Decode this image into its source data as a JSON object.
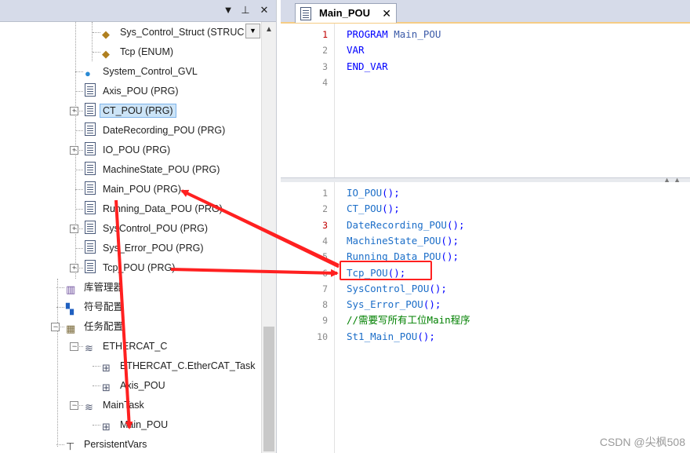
{
  "tree": {
    "rows": [
      {
        "label": "Sys_Control_Struct (STRUC",
        "icon": "struct-type-icon"
      },
      {
        "label": "Tcp (ENUM)",
        "icon": "enum-type-icon"
      },
      {
        "label": "System_Control_GVL",
        "icon": "globe-gvl-icon"
      },
      {
        "label": "Axis_POU (PRG)",
        "icon": "program-doc-icon"
      },
      {
        "label": "CT_POU (PRG)",
        "icon": "program-doc-icon",
        "selected": true
      },
      {
        "label": "DateRecording_POU (PRG)",
        "icon": "program-doc-icon"
      },
      {
        "label": "IO_POU (PRG)",
        "icon": "program-doc-icon"
      },
      {
        "label": "MachineState_POU (PRG)",
        "icon": "program-doc-icon"
      },
      {
        "label": "Main_POU (PRG)",
        "icon": "program-doc-icon"
      },
      {
        "label": "Running_Data_POU (PRG)",
        "icon": "program-doc-icon"
      },
      {
        "label": "SysControl_POU (PRG)",
        "icon": "program-doc-icon"
      },
      {
        "label": "Sys_Error_POU (PRG)",
        "icon": "program-doc-icon"
      },
      {
        "label": "Tcp_POU (PRG)",
        "icon": "program-doc-icon"
      },
      {
        "label": "库管理器",
        "icon": "library-manager-icon"
      },
      {
        "label": "符号配置",
        "icon": "symbol-config-icon"
      },
      {
        "label": "任务配置",
        "icon": "task-config-icon"
      },
      {
        "label": "ETHERCAT_C",
        "icon": "task-icon"
      },
      {
        "label": "ETHERCAT_C.EtherCAT_Task",
        "icon": "task-call-icon"
      },
      {
        "label": "Axis_POU",
        "icon": "task-call-icon"
      },
      {
        "label": "MainTask",
        "icon": "task-icon"
      },
      {
        "label": "Main_POU",
        "icon": "task-call-icon"
      },
      {
        "label": "PersistentVars",
        "icon": "persistent-vars-icon"
      }
    ]
  },
  "editor": {
    "tab_label": "Main_POU",
    "tab_close": "✕",
    "declaration": [
      {
        "no": "1",
        "modified": true,
        "text": "PROGRAM Main_POU"
      },
      {
        "no": "2",
        "modified": false,
        "text": "VAR"
      },
      {
        "no": "3",
        "modified": false,
        "text": "END_VAR"
      },
      {
        "no": "4",
        "modified": false,
        "text": ""
      }
    ],
    "implementation": [
      {
        "no": "1",
        "modified": false,
        "text": "IO_POU();"
      },
      {
        "no": "2",
        "modified": false,
        "text": "CT_POU();"
      },
      {
        "no": "3",
        "modified": true,
        "text": "DateRecording_POU();"
      },
      {
        "no": "4",
        "modified": false,
        "text": "MachineState_POU();"
      },
      {
        "no": "5",
        "modified": false,
        "text": "Running_Data_POU();"
      },
      {
        "no": "6",
        "modified": false,
        "text": "Tcp_POU();"
      },
      {
        "no": "7",
        "modified": false,
        "text": "SysControl_POU();"
      },
      {
        "no": "8",
        "modified": false,
        "text": "Sys_Error_POU();"
      },
      {
        "no": "9",
        "modified": false,
        "text": "//需要写所有工位Main程序"
      },
      {
        "no": "10",
        "modified": false,
        "text": "St1_Main_POU();"
      }
    ]
  },
  "watermark": "CSDN @尖枫508",
  "colors": {
    "annotation_red": "#ff2020",
    "keyword": "#0000ff",
    "comment": "#008000",
    "selection": "#cce4f7"
  }
}
